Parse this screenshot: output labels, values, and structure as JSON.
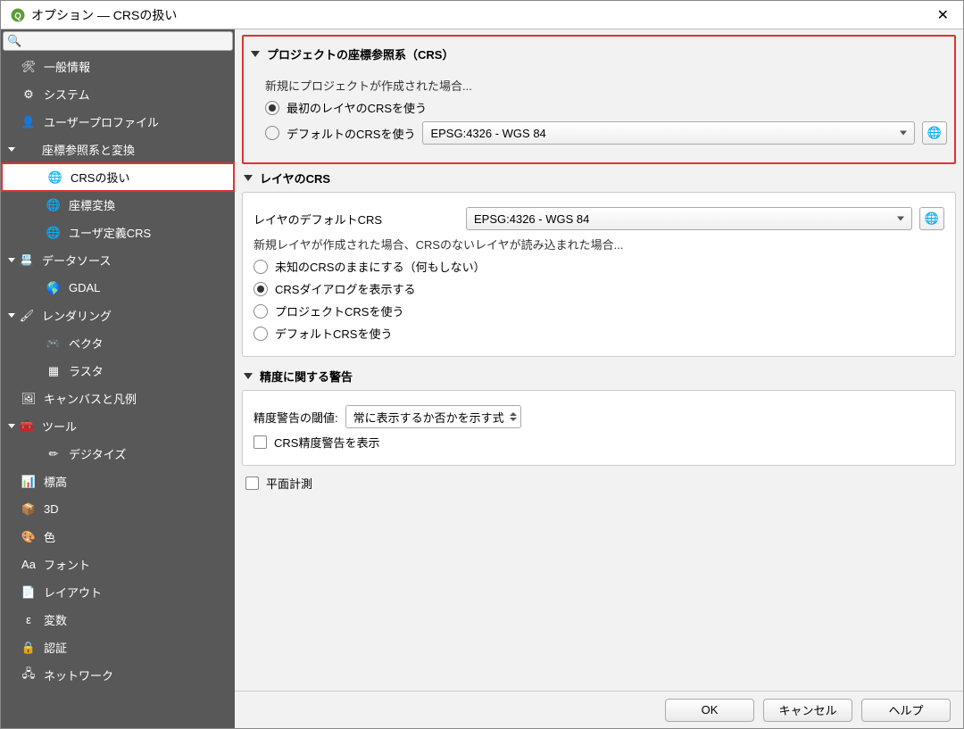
{
  "title": "オプション — CRSの扱い",
  "search_placeholder": "",
  "sidebar": [
    {
      "label": "一般情報",
      "depth": 1,
      "icon": "🛠"
    },
    {
      "label": "システム",
      "depth": 1,
      "icon": "⚙"
    },
    {
      "label": "ユーザープロファイル",
      "depth": 1,
      "icon": "👤"
    },
    {
      "label": "座標参照系と変換",
      "depth": 0,
      "icon": "",
      "expanded": true
    },
    {
      "label": "CRSの扱い",
      "depth": 2,
      "icon": "🌐",
      "selected": true
    },
    {
      "label": "座標変換",
      "depth": 2,
      "icon": "🌐"
    },
    {
      "label": "ユーザ定義CRS",
      "depth": 2,
      "icon": "🌐"
    },
    {
      "label": "データソース",
      "depth": 0,
      "icon": "📇",
      "expanded": true
    },
    {
      "label": "GDAL",
      "depth": 2,
      "icon": "🌎"
    },
    {
      "label": "レンダリング",
      "depth": 0,
      "icon": "🖌",
      "expanded": true
    },
    {
      "label": "ベクタ",
      "depth": 2,
      "icon": "🎮"
    },
    {
      "label": "ラスタ",
      "depth": 2,
      "icon": "▦"
    },
    {
      "label": "キャンバスと凡例",
      "depth": 1,
      "icon": "🖼"
    },
    {
      "label": "ツール",
      "depth": 0,
      "icon": "🧰",
      "expanded": true
    },
    {
      "label": "デジタイズ",
      "depth": 2,
      "icon": "✏"
    },
    {
      "label": "標高",
      "depth": 1,
      "icon": "📊"
    },
    {
      "label": "3D",
      "depth": 1,
      "icon": "📦"
    },
    {
      "label": "色",
      "depth": 1,
      "icon": "🎨"
    },
    {
      "label": "フォント",
      "depth": 1,
      "icon": "Aa"
    },
    {
      "label": "レイアウト",
      "depth": 1,
      "icon": "📄"
    },
    {
      "label": "変数",
      "depth": 1,
      "icon": "ε"
    },
    {
      "label": "認証",
      "depth": 1,
      "icon": "🔒"
    },
    {
      "label": "ネットワーク",
      "depth": 1,
      "icon": "🖧"
    }
  ],
  "sections": {
    "project_crs": {
      "title": "プロジェクトの座標参照系（CRS）",
      "when_created": "新規にプロジェクトが作成された場合...",
      "opt_first_layer": "最初のレイヤのCRSを使う",
      "opt_default": "デフォルトのCRSを使う",
      "default_crs": "EPSG:4326 - WGS 84"
    },
    "layer_crs": {
      "title": "レイヤのCRS",
      "default_label": "レイヤのデフォルトCRS",
      "default_value": "EPSG:4326 - WGS 84",
      "when_new": "新規レイヤが作成された場合、CRSのないレイヤが読み込まれた場合...",
      "opt_unknown": "未知のCRSのままにする（何もしない）",
      "opt_dialog": "CRSダイアログを表示する",
      "opt_project": "プロジェクトCRSを使う",
      "opt_default": "デフォルトCRSを使う"
    },
    "accuracy": {
      "title": "精度に関する警告",
      "threshold_label": "精度警告の閾値:",
      "threshold_value": "常に表示するか否かを示す式",
      "show_warning": "CRS精度警告を表示"
    },
    "planimetric": "平面計測"
  },
  "buttons": {
    "ok": "OK",
    "cancel": "キャンセル",
    "help": "ヘルプ"
  }
}
